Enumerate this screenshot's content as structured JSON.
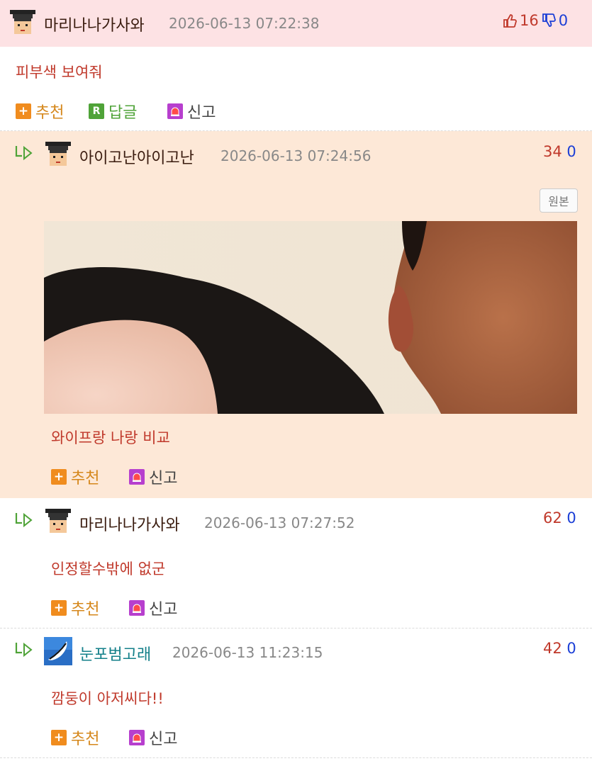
{
  "comments": [
    {
      "author": "마리나나가사와",
      "date": "2026-06-13 07:22:38",
      "text": "피부색 보여줘",
      "up": "16",
      "down": "0",
      "actions": {
        "recommend": "추천",
        "reply": "답글",
        "report": "신고"
      }
    },
    {
      "author": "아이고난아이고난",
      "date": "2026-06-13 07:24:56",
      "text": "와이프랑 나랑 비교",
      "up": "34",
      "down": "0",
      "original_label": "원본",
      "actions": {
        "recommend": "추천",
        "report": "신고"
      }
    },
    {
      "author": "마리나나가사와",
      "date": "2026-06-13 07:27:52",
      "text": "인정할수밖에 없군",
      "up": "62",
      "down": "0",
      "actions": {
        "recommend": "추천",
        "report": "신고"
      }
    },
    {
      "author": "눈포범고래",
      "date": "2026-06-13 11:23:15",
      "text": "깜둥이 아저씨다!!",
      "up": "42",
      "down": "0",
      "actions": {
        "recommend": "추천",
        "report": "신고"
      }
    }
  ],
  "colors": {
    "header_pink": "#fde2e4",
    "reply_peach": "#fde8d7",
    "name_dark": "#3a1c0f",
    "name_teal": "#14808a",
    "text_red": "#c0392b",
    "up_red": "#c0392b",
    "down_blue": "#1c3fd6",
    "action_orange": "#d5871b"
  }
}
